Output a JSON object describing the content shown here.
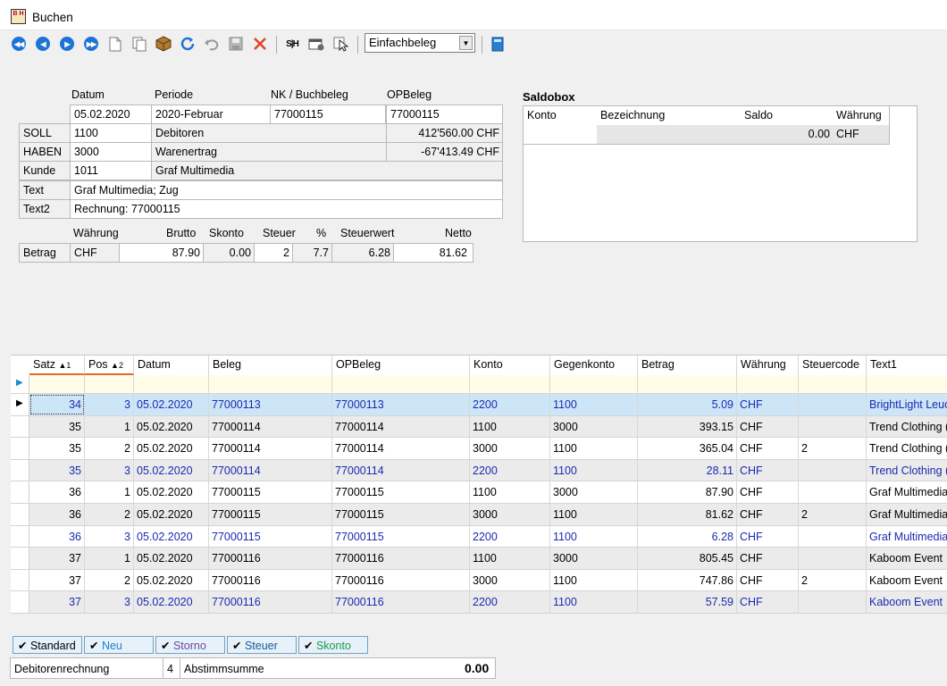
{
  "window": {
    "title": "Buchen",
    "app_icon_text": "B H"
  },
  "toolbar": {
    "split_label": "S|H",
    "mode_select": "Einfachbeleg"
  },
  "form": {
    "headers": {
      "datum": "Datum",
      "periode": "Periode",
      "nk": "NK / Buchbeleg",
      "opbeleg": "OPBeleg"
    },
    "datum": "05.02.2020",
    "periode": "2020-Februar",
    "nk": "77000115",
    "opbeleg": "77000115",
    "soll": {
      "label": "SOLL",
      "konto": "1100",
      "name": "Debitoren",
      "saldo": "412'560.00 CHF"
    },
    "haben": {
      "label": "HABEN",
      "konto": "3000",
      "name": "Warenertrag",
      "saldo": "-67'413.49 CHF"
    },
    "kunde": {
      "label": "Kunde",
      "nr": "1011",
      "name": "Graf Multimedia"
    },
    "text": {
      "label": "Text",
      "value": "Graf Multimedia; Zug"
    },
    "text2": {
      "label": "Text2",
      "value": "Rechnung: 77000115"
    },
    "betrag": {
      "headers": {
        "waehrung": "Währung",
        "brutto": "Brutto",
        "skonto": "Skonto",
        "steuer": "Steuer",
        "pct": "%",
        "steuerwert": "Steuerwert",
        "netto": "Netto"
      },
      "label": "Betrag",
      "waehrung": "CHF",
      "brutto": "87.90",
      "skonto": "0.00",
      "steuer": "2",
      "pct": "7.7",
      "steuerwert": "6.28",
      "netto": "81.62"
    }
  },
  "saldobox": {
    "title": "Saldobox",
    "headers": [
      "Konto",
      "Bezeichnung",
      "Saldo",
      "Währung"
    ],
    "row": {
      "konto": "",
      "bezeichnung": "",
      "saldo": "0.00",
      "waehrung": "CHF"
    }
  },
  "grid": {
    "headers": [
      "Satz",
      "Pos",
      "Datum",
      "Beleg",
      "OPBeleg",
      "Konto",
      "Gegenkonto",
      "Betrag",
      "Währung",
      "Steuercode",
      "Text1"
    ],
    "sort": {
      "satz": "▲1",
      "pos": "▲2"
    },
    "rows": [
      {
        "satz": "34",
        "pos": "3",
        "datum": "05.02.2020",
        "beleg": "77000113",
        "opbeleg": "77000113",
        "konto": "2200",
        "gegenkonto": "1100",
        "betrag": "5.09",
        "waehrung": "CHF",
        "steuercode": "",
        "text1": "BrightLight Leuc",
        "blue": true,
        "selected": true
      },
      {
        "satz": "35",
        "pos": "1",
        "datum": "05.02.2020",
        "beleg": "77000114",
        "opbeleg": "77000114",
        "konto": "1100",
        "gegenkonto": "3000",
        "betrag": "393.15",
        "waehrung": "CHF",
        "steuercode": "",
        "text1": "Trend Clothing (",
        "blue": false,
        "selected": false
      },
      {
        "satz": "35",
        "pos": "2",
        "datum": "05.02.2020",
        "beleg": "77000114",
        "opbeleg": "77000114",
        "konto": "3000",
        "gegenkonto": "1100",
        "betrag": "365.04",
        "waehrung": "CHF",
        "steuercode": "2",
        "text1": "Trend Clothing (",
        "blue": false,
        "selected": false
      },
      {
        "satz": "35",
        "pos": "3",
        "datum": "05.02.2020",
        "beleg": "77000114",
        "opbeleg": "77000114",
        "konto": "2200",
        "gegenkonto": "1100",
        "betrag": "28.11",
        "waehrung": "CHF",
        "steuercode": "",
        "text1": "Trend Clothing (",
        "blue": true,
        "selected": false
      },
      {
        "satz": "36",
        "pos": "1",
        "datum": "05.02.2020",
        "beleg": "77000115",
        "opbeleg": "77000115",
        "konto": "1100",
        "gegenkonto": "3000",
        "betrag": "87.90",
        "waehrung": "CHF",
        "steuercode": "",
        "text1": "Graf Multimedia",
        "blue": false,
        "selected": false
      },
      {
        "satz": "36",
        "pos": "2",
        "datum": "05.02.2020",
        "beleg": "77000115",
        "opbeleg": "77000115",
        "konto": "3000",
        "gegenkonto": "1100",
        "betrag": "81.62",
        "waehrung": "CHF",
        "steuercode": "2",
        "text1": "Graf Multimedia",
        "blue": false,
        "selected": false
      },
      {
        "satz": "36",
        "pos": "3",
        "datum": "05.02.2020",
        "beleg": "77000115",
        "opbeleg": "77000115",
        "konto": "2200",
        "gegenkonto": "1100",
        "betrag": "6.28",
        "waehrung": "CHF",
        "steuercode": "",
        "text1": "Graf Multimedia",
        "blue": true,
        "selected": false
      },
      {
        "satz": "37",
        "pos": "1",
        "datum": "05.02.2020",
        "beleg": "77000116",
        "opbeleg": "77000116",
        "konto": "1100",
        "gegenkonto": "3000",
        "betrag": "805.45",
        "waehrung": "CHF",
        "steuercode": "",
        "text1": "Kaboom Event",
        "blue": false,
        "selected": false
      },
      {
        "satz": "37",
        "pos": "2",
        "datum": "05.02.2020",
        "beleg": "77000116",
        "opbeleg": "77000116",
        "konto": "3000",
        "gegenkonto": "1100",
        "betrag": "747.86",
        "waehrung": "CHF",
        "steuercode": "2",
        "text1": "Kaboom Event",
        "blue": false,
        "selected": false
      },
      {
        "satz": "37",
        "pos": "3",
        "datum": "05.02.2020",
        "beleg": "77000116",
        "opbeleg": "77000116",
        "konto": "2200",
        "gegenkonto": "1100",
        "betrag": "57.59",
        "waehrung": "CHF",
        "steuercode": "",
        "text1": "Kaboom Event",
        "blue": true,
        "selected": false
      }
    ]
  },
  "filters": [
    {
      "label": "Standard",
      "color": "#000000"
    },
    {
      "label": "Neu",
      "color": "#1a7fd0"
    },
    {
      "label": "Storno",
      "color": "#6a4aa0"
    },
    {
      "label": "Steuer",
      "color": "#1a5aa0"
    },
    {
      "label": "Skonto",
      "color": "#1a9a4a"
    }
  ],
  "status": {
    "doc_type": "Debitorenrechnung",
    "count": "4",
    "sum_label": "Abstimmsumme",
    "sum_value": "0.00"
  },
  "colors": {
    "blue_text": "#1a2ab0",
    "selected_row": "#cde6f7",
    "nav_blue": "#1d73d6",
    "grid_row_alt": "#ebebeb"
  }
}
